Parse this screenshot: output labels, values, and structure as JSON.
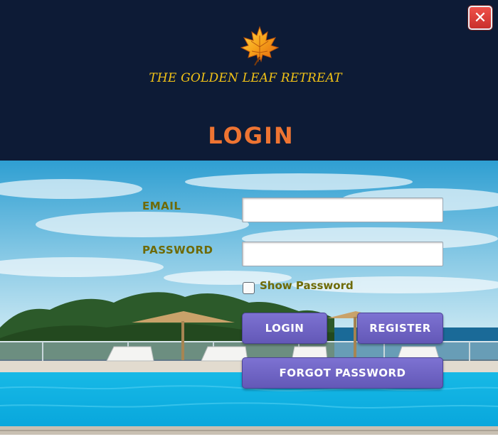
{
  "window": {
    "close_glyph": "✕",
    "brand_name": "THE GOLDEN LEAF RETREAT",
    "logo_icon": "maple-leaf-icon"
  },
  "login": {
    "title": "LOGIN",
    "email_label": "EMAIL",
    "email_value": "",
    "password_label": "PASSWORD",
    "password_value": "",
    "show_password_label": "Show Password",
    "show_password_checked": false,
    "login_button": "LOGIN",
    "register_button": "REGISTER",
    "forgot_password_button": "FORGOT PASSWORD"
  },
  "colors": {
    "header_bg": "#0d1b36",
    "brand_text": "#f3c316",
    "title_orange": "#ee7432",
    "label_olive": "#6e6a06",
    "button_purple": "#6f64c4",
    "close_red": "#d83a34"
  }
}
